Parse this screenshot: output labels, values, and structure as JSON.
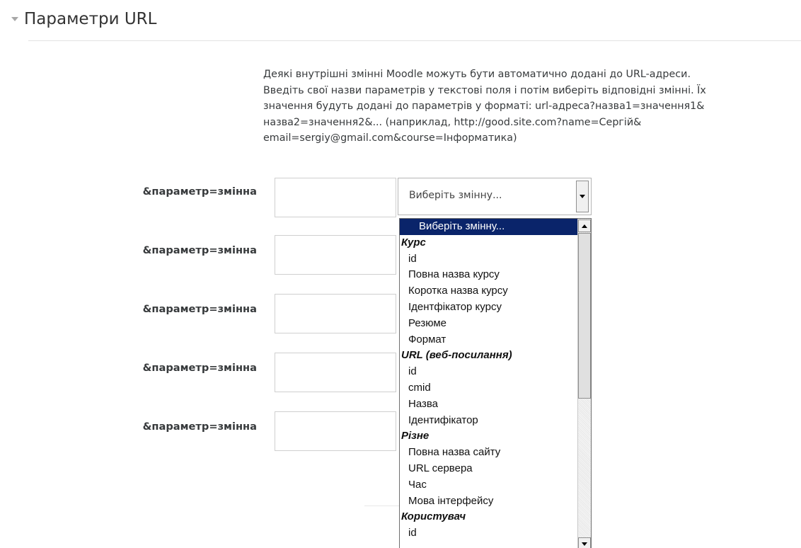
{
  "section": {
    "title": "Параметри URL",
    "icon": "triangle-down-icon"
  },
  "description": [
    "Деякі внутрішні змінні Moodle можуть бути автоматично додані до URL-адреси.",
    "Введіть свої назви параметрів у текстові поля і потім виберіть відповідні змінні. Їх",
    "значення будуть додані до параметрів у форматі: url-адреса?назва1=значення1&",
    "назва2=значення2&... (наприклад, http://good.site.com?name=Сергій&",
    "email=sergiy@gmail.com&course=Інформатика)"
  ],
  "rows": [
    {
      "label": "&параметр=змінна",
      "value": ""
    },
    {
      "label": "&параметр=змінна",
      "value": ""
    },
    {
      "label": "&параметр=змінна",
      "value": ""
    },
    {
      "label": "&параметр=змінна",
      "value": ""
    },
    {
      "label": "&параметр=змінна",
      "value": ""
    }
  ],
  "select": {
    "value": "Виберіть змінну..."
  },
  "dropdown": {
    "selected": "Виберіть змінну...",
    "groups": [
      {
        "label": "Курс",
        "items": [
          "id",
          "Повна назва курсу",
          "Коротка назва курсу",
          "Ідентфікатор курсу",
          "Резюме",
          "Формат"
        ]
      },
      {
        "label": "URL (веб-посилання)",
        "items": [
          "id",
          "cmid",
          "Назва",
          "Ідентифікатор"
        ]
      },
      {
        "label": "Різне",
        "items": [
          "Повна назва сайту",
          "URL сервера",
          "Час",
          "Мова інтерфейсу"
        ]
      },
      {
        "label": "Користувач",
        "items": [
          "id"
        ]
      }
    ]
  },
  "colors": {
    "highlight": "#0a246a",
    "border": "#cfcfcf"
  }
}
